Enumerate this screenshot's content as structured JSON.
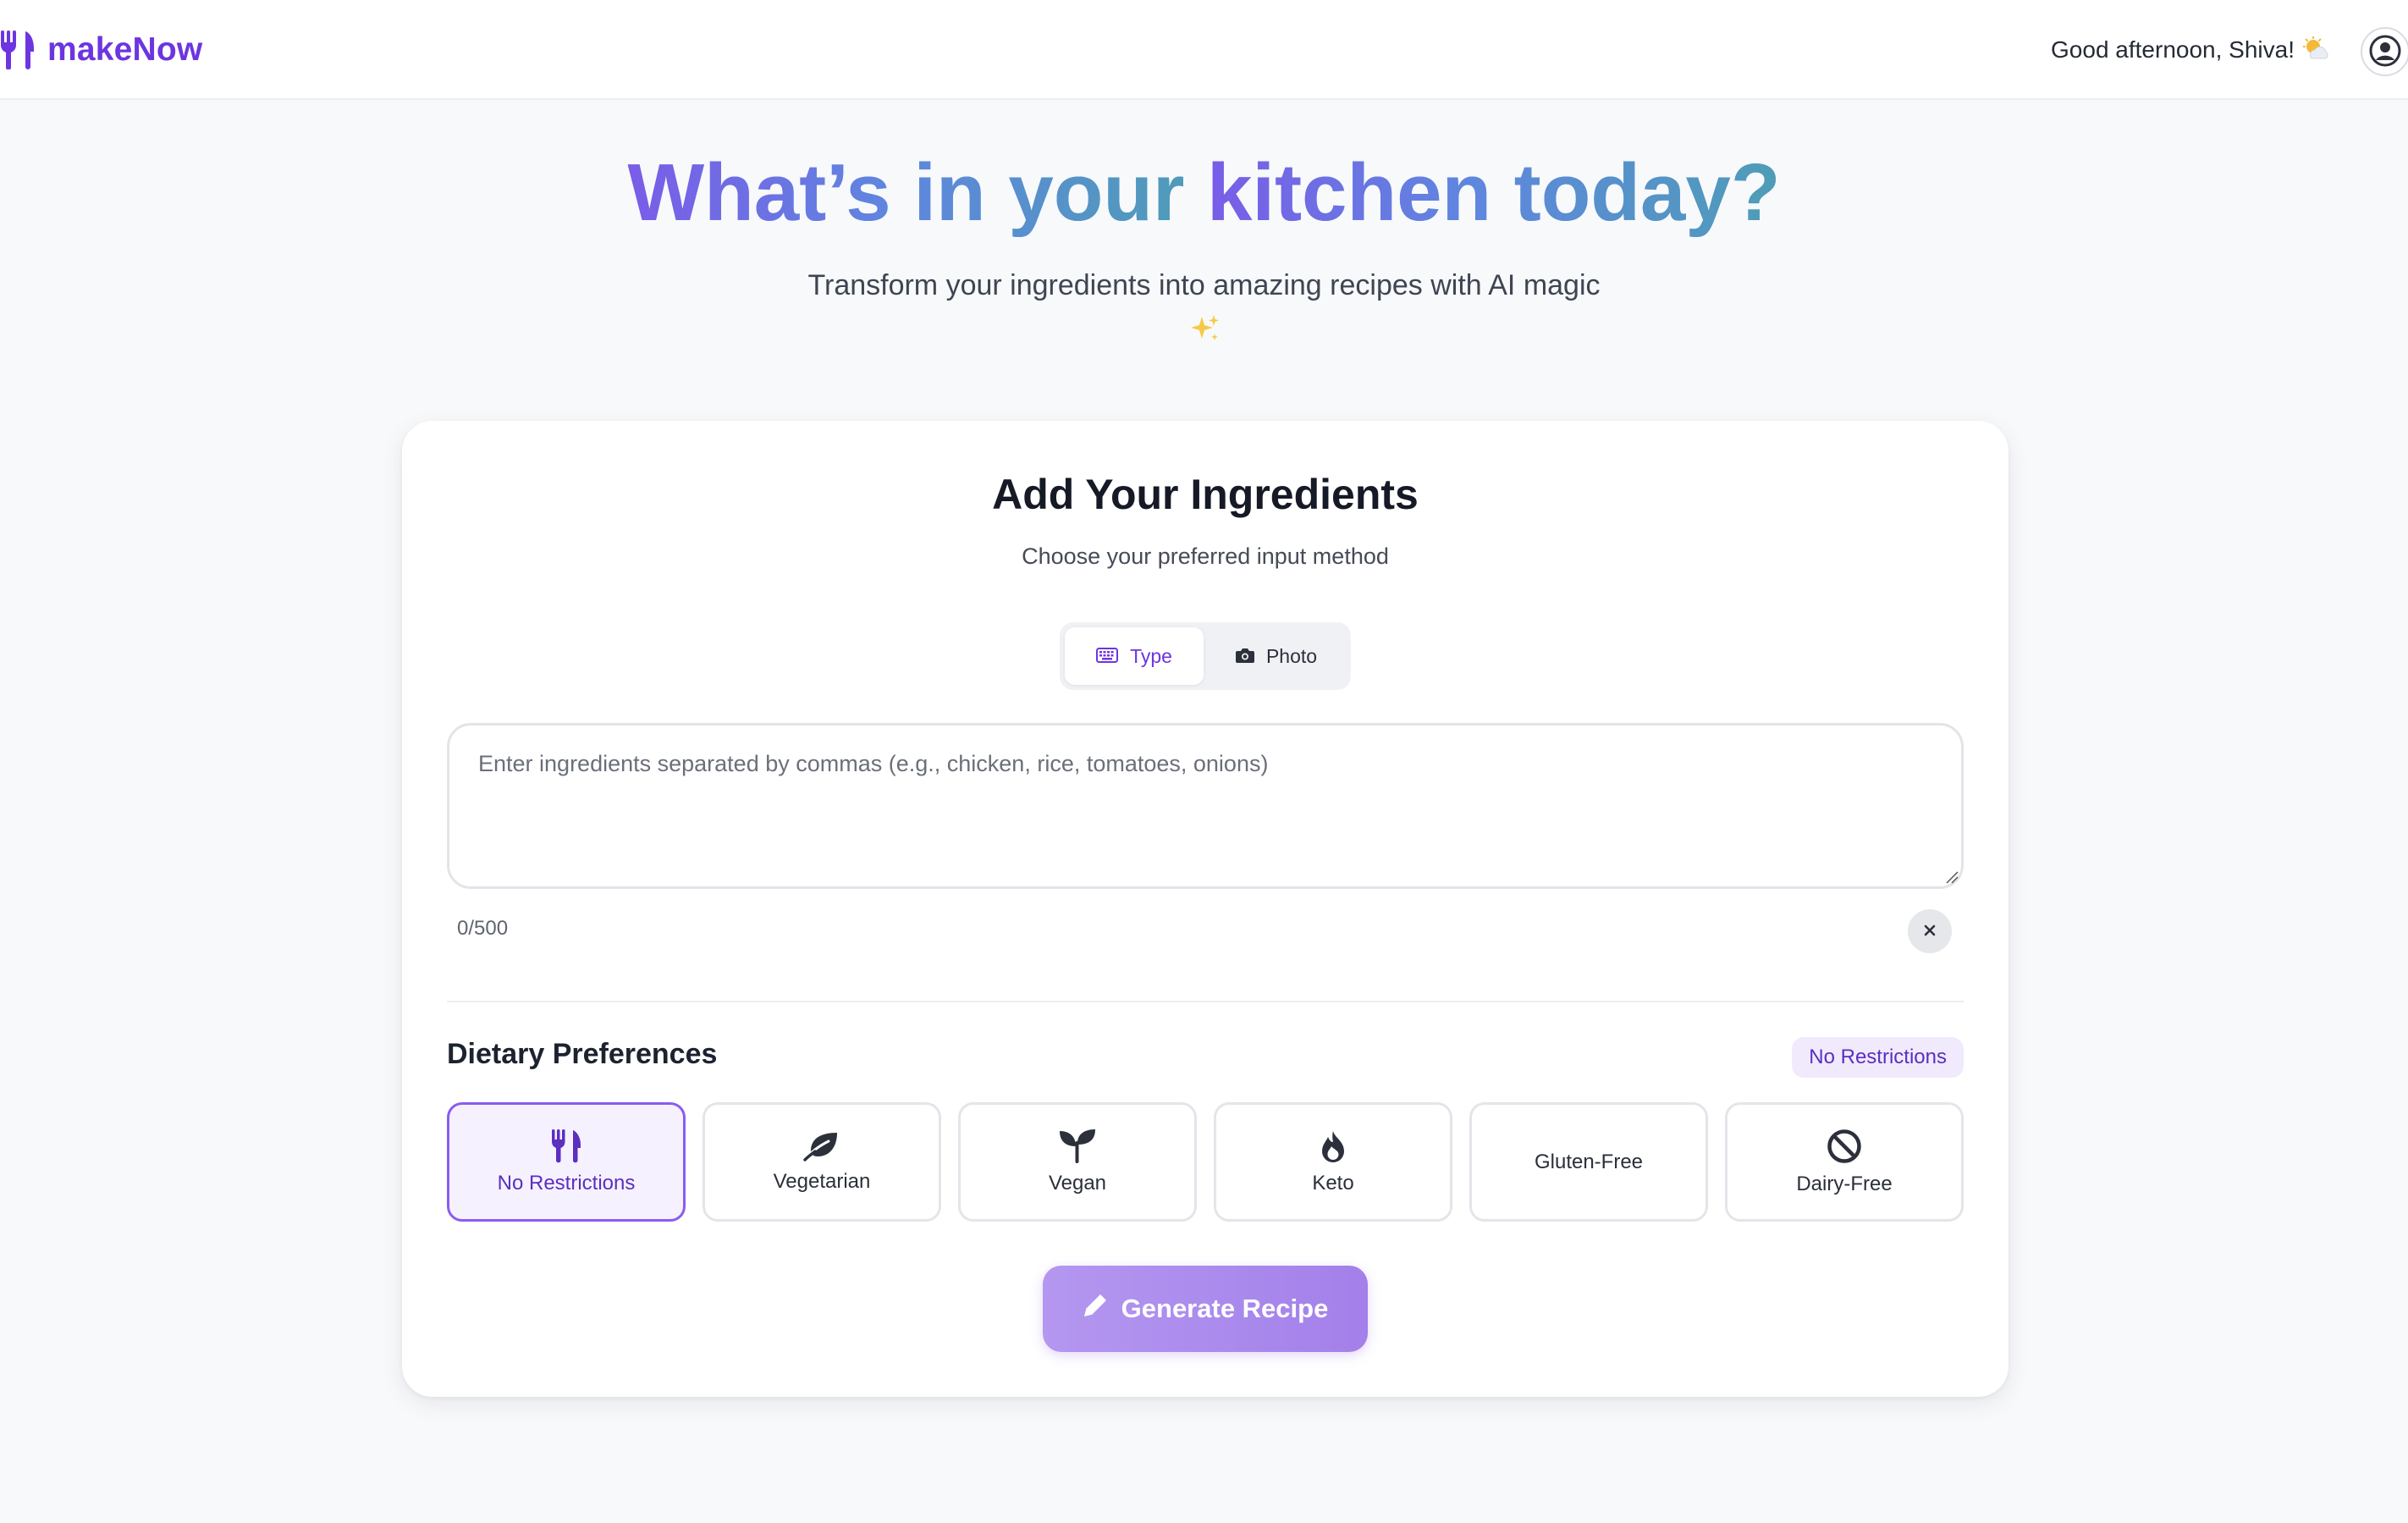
{
  "header": {
    "brand_name": "makeNow",
    "greeting": "Good afternoon, Shiva!",
    "greeting_icon": "sun-behind-cloud-icon",
    "avatar_icon": "user-circle-icon"
  },
  "hero": {
    "title_part1": "What’s in your ",
    "title_part2": "kitchen today?",
    "subtitle": "Transform your ingredients into amazing recipes with AI magic",
    "sparkle_icon": "sparkles-icon"
  },
  "card": {
    "title": "Add Your Ingredients",
    "subtitle": "Choose your preferred input method",
    "modes": [
      {
        "label": "Type",
        "icon": "keyboard-icon",
        "active": true
      },
      {
        "label": "Photo",
        "icon": "camera-icon",
        "active": false
      }
    ],
    "ingredients": {
      "value": "",
      "placeholder": "Enter ingredients separated by commas (e.g., chicken, rice, tomatoes, onions)",
      "char_count": "0/500"
    },
    "diet": {
      "title": "Dietary Preferences",
      "selected_badge": "No Restrictions",
      "options": [
        {
          "label": "No Restrictions",
          "icon": "utensils-icon",
          "selected": true
        },
        {
          "label": "Vegetarian",
          "icon": "leaf-icon",
          "selected": false
        },
        {
          "label": "Vegan",
          "icon": "seedling-icon",
          "selected": false
        },
        {
          "label": "Keto",
          "icon": "fire-icon",
          "selected": false
        },
        {
          "label": "Gluten-Free",
          "icon": "",
          "selected": false
        },
        {
          "label": "Dairy-Free",
          "icon": "ban-icon",
          "selected": false
        }
      ]
    },
    "generate_label": "Generate Recipe",
    "generate_icon": "pencil-icon"
  },
  "colors": {
    "brand": "#6d35e0",
    "title_gradient_start": "#7a5ce8",
    "title_gradient_end": "#4e9db6",
    "button_gradient_start": "#b497f0",
    "button_gradient_end": "#a380ea",
    "selected_border": "#8a5cf0",
    "page_background": "#f8f9fb"
  }
}
